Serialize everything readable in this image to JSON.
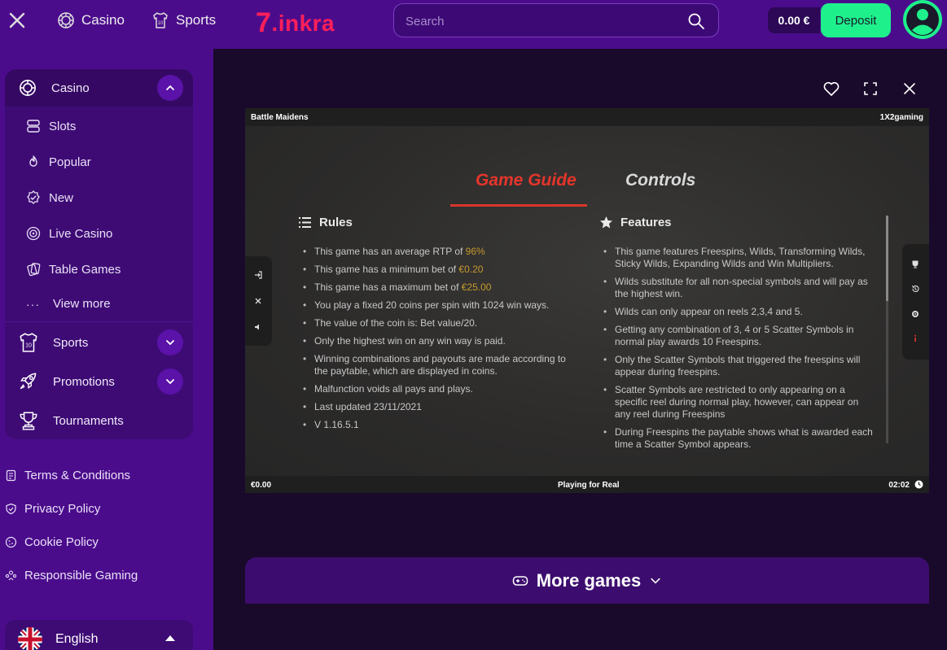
{
  "header": {
    "nav": [
      {
        "label": "Casino",
        "icon": "casino-chip-icon"
      },
      {
        "label": "Sports",
        "icon": "jersey-icon"
      }
    ],
    "logo_mark": "7",
    "logo_text": ".inkra",
    "search_placeholder": "Search",
    "balance": "0.00 €",
    "deposit_label": "Deposit"
  },
  "sidebar": {
    "casino_label": "Casino",
    "casino_items": [
      {
        "label": "Slots",
        "icon": "slots-icon"
      },
      {
        "label": "Popular",
        "icon": "flame-icon"
      },
      {
        "label": "New",
        "icon": "new-badge-icon"
      },
      {
        "label": "Live Casino",
        "icon": "roulette-icon"
      },
      {
        "label": "Table Games",
        "icon": "cards-icon"
      }
    ],
    "view_more_label": "View more",
    "sports_label": "Sports",
    "promotions_label": "Promotions",
    "tournaments_label": "Tournaments",
    "footer_links": [
      {
        "label": "Terms & Conditions",
        "icon": "document-icon"
      },
      {
        "label": "Privacy Policy",
        "icon": "shield-icon"
      },
      {
        "label": "Cookie Policy",
        "icon": "cookie-icon"
      },
      {
        "label": "Responsible Gaming",
        "icon": "hands-icon"
      }
    ],
    "language": "English"
  },
  "game": {
    "title": "Battle Maidens",
    "provider": "1X2gaming",
    "tabs": [
      "Game Guide",
      "Controls"
    ],
    "active_tab": "Game Guide",
    "rules_title": "Rules",
    "rules": [
      {
        "text": "This game has an average RTP of ",
        "highlight": "96%"
      },
      {
        "text": "This game has a minimum bet of ",
        "highlight": "€0.20"
      },
      {
        "text": "This game has a maximum bet of ",
        "highlight": "€25.00"
      },
      {
        "text": "You play a fixed 20 coins per spin with 1024 win ways.",
        "highlight": ""
      },
      {
        "text": "The value of the coin is: Bet value/20.",
        "highlight": ""
      },
      {
        "text": "Only the highest win on any win way is paid.",
        "highlight": ""
      },
      {
        "text": "Winning combinations and payouts are made according to the paytable, which are displayed in coins.",
        "highlight": ""
      },
      {
        "text": "Malfunction voids all pays and plays.",
        "highlight": ""
      },
      {
        "text": "Last updated 23/11/2021",
        "highlight": ""
      },
      {
        "text": "V 1.16.5.1",
        "highlight": ""
      }
    ],
    "features_title": "Features",
    "features": [
      "This game features Freespins, Wilds, Transforming Wilds, Sticky Wilds, Expanding Wilds and Win Multipliers.",
      "Wilds substitute for all non-special symbols and will pay as the highest win.",
      "Wilds can only appear on reels 2,3,4 and 5.",
      "Getting any combination of 3, 4 or 5 Scatter Symbols in normal play awards 10 Freespins.",
      "Only the Scatter Symbols that triggered the freespins will appear during freespins.",
      "Scatter Symbols are restricted to only appearing on a specific reel during normal play, however, can appear on any reel during Freespins",
      "During Freespins the paytable shows what is awarded each time a Scatter Symbol appears."
    ],
    "balance": "€0.00",
    "mode": "Playing for Real",
    "time": "02:02"
  },
  "more_games_label": "More games",
  "colors": {
    "header_bg": "#4b0c8c",
    "accent_green": "#1ef08c",
    "brand_red": "#ff1f5a",
    "highlight_gold": "#c59a2d",
    "tab_red": "#e5352b"
  }
}
